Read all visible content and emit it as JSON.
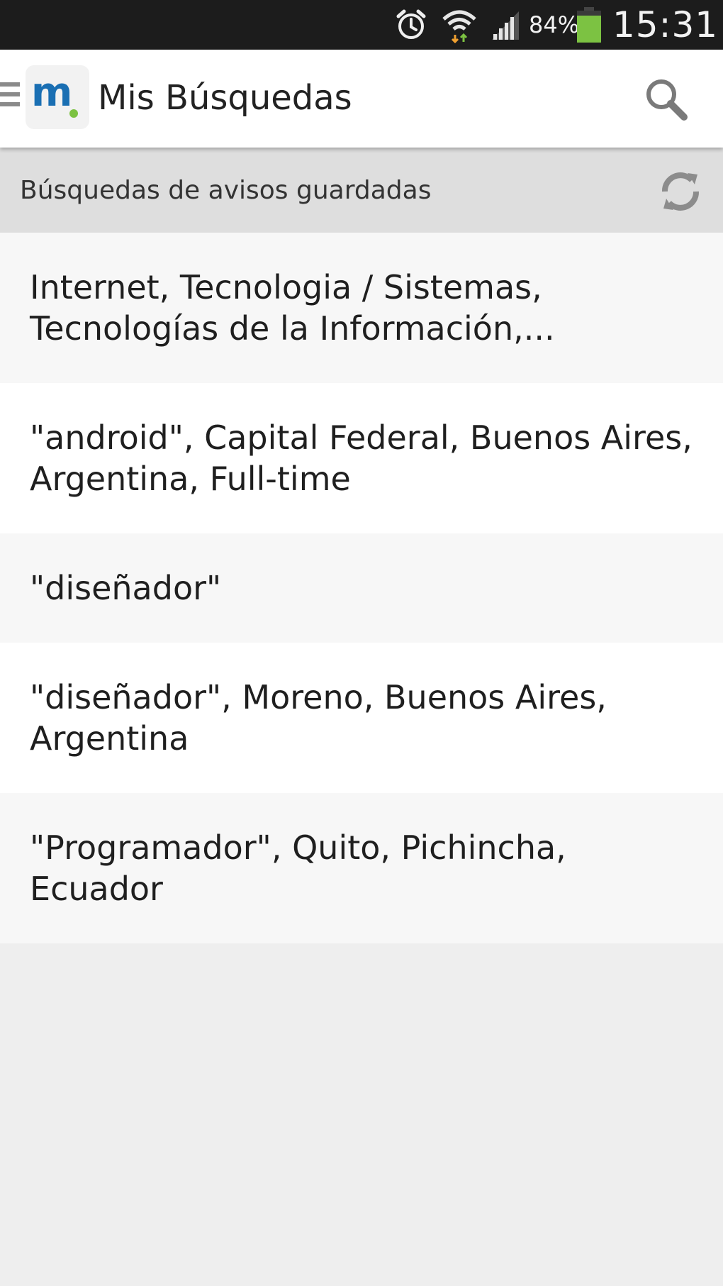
{
  "status_bar": {
    "battery_percent": "84%",
    "time": "15:31",
    "icons": [
      "alarm-icon",
      "wifi-icon",
      "signal-icon",
      "battery-icon"
    ],
    "battery_color": "#7cc242"
  },
  "app_bar": {
    "title": "Mis Búsquedas",
    "logo_text": "m",
    "logo_colors": {
      "letter": "#1a6fb3",
      "dot": "#7cc242"
    },
    "icons": [
      "menu-icon",
      "search-icon"
    ]
  },
  "section": {
    "label": "Búsquedas de avisos guardadas",
    "icon": "refresh-icon"
  },
  "saved_searches": [
    "Internet, Tecnologia / Sistemas, Tecnologías de la Información,...",
    "\"android\", Capital Federal, Buenos Aires, Argentina, Full-time",
    "\"diseñador\"",
    "\"diseñador\", Moreno, Buenos Aires, Argentina",
    "\"Programador\", Quito, Pichincha, Ecuador"
  ]
}
